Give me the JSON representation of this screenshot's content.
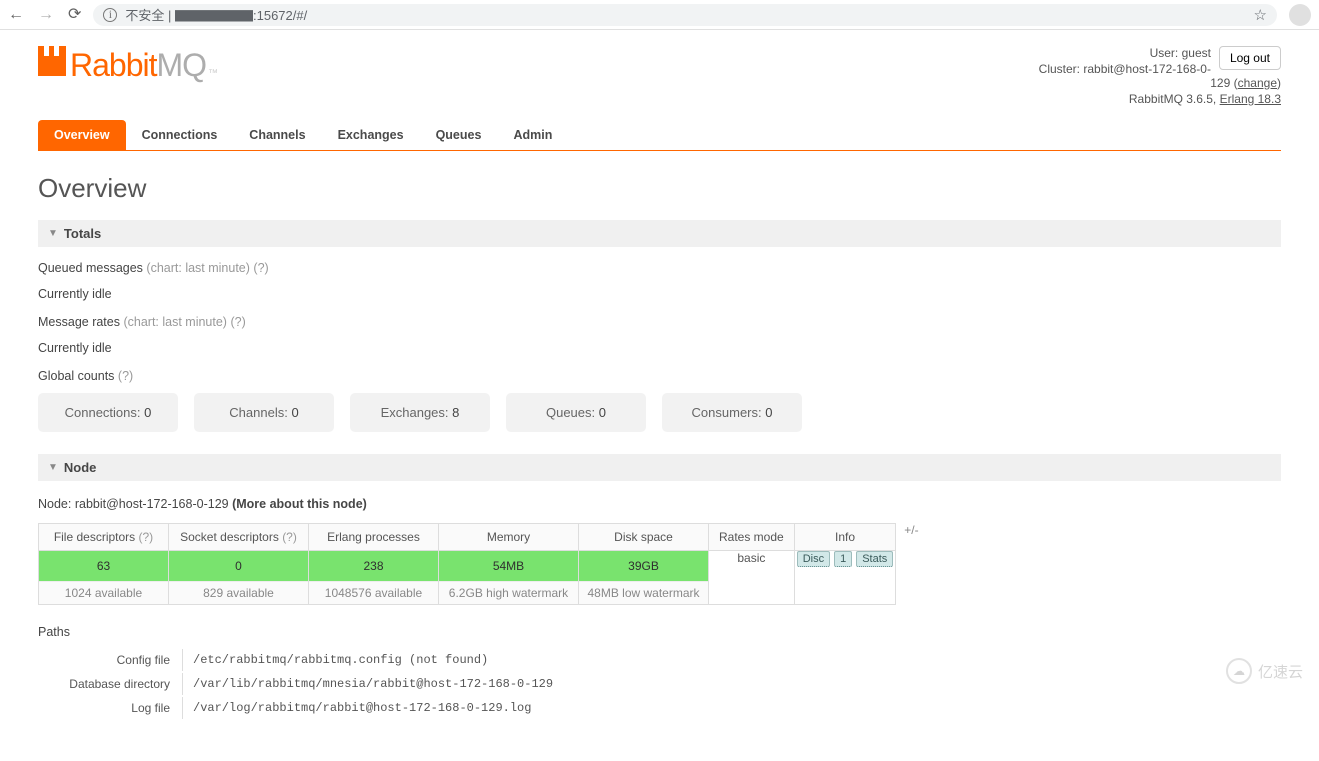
{
  "chrome": {
    "url_prefix": "不安全 |",
    "url": ":15672/#/",
    "url_text": "不安全 | ▇▇▇▇▇▇:15672/#/"
  },
  "logo": {
    "part1": "Rabbit",
    "part2": "MQ",
    "tm": "™"
  },
  "header": {
    "user_label": "User:",
    "user": "guest",
    "cluster_label": "Cluster:",
    "cluster": "rabbit@host-172-168-0-129",
    "change": "change",
    "version": "RabbitMQ 3.6.5,",
    "erlang": "Erlang 18.3",
    "logout": "Log out"
  },
  "tabs": [
    "Overview",
    "Connections",
    "Channels",
    "Exchanges",
    "Queues",
    "Admin"
  ],
  "page_title": "Overview",
  "sections": {
    "totals": "Totals",
    "node": "Node"
  },
  "totals": {
    "queued_label": "Queued messages",
    "chart_hint": "(chart: last minute)",
    "help": "(?)",
    "idle1": "Currently idle",
    "rates_label": "Message rates",
    "idle2": "Currently idle",
    "global_label": "Global counts"
  },
  "counts": [
    {
      "label": "Connections:",
      "value": "0"
    },
    {
      "label": "Channels:",
      "value": "0"
    },
    {
      "label": "Exchanges:",
      "value": "8"
    },
    {
      "label": "Queues:",
      "value": "0"
    },
    {
      "label": "Consumers:",
      "value": "0"
    }
  ],
  "node": {
    "line_label": "Node:",
    "name": "rabbit@host-172-168-0-129",
    "more": "(More about this node)",
    "headers": [
      "File descriptors",
      "Socket descriptors",
      "Erlang processes",
      "Memory",
      "Disk space",
      "Rates mode",
      "Info"
    ],
    "help": "(?)",
    "cells": {
      "fd_val": "63",
      "fd_sub": "1024 available",
      "sd_val": "0",
      "sd_sub": "829 available",
      "ep_val": "238",
      "ep_sub": "1048576 available",
      "mem_val": "54MB",
      "mem_sub": "6.2GB high watermark",
      "disk_val": "39GB",
      "disk_sub": "48MB low watermark",
      "rates": "basic",
      "info": [
        "Disc",
        "1",
        "Stats"
      ]
    },
    "plusminus": "+/-"
  },
  "paths": {
    "title": "Paths",
    "rows": [
      {
        "label": "Config file",
        "value": "/etc/rabbitmq/rabbitmq.config (not found)"
      },
      {
        "label": "Database directory",
        "value": "/var/lib/rabbitmq/mnesia/rabbit@host-172-168-0-129"
      },
      {
        "label": "Log file",
        "value": "/var/log/rabbitmq/rabbit@host-172-168-0-129.log"
      }
    ]
  },
  "watermark": "亿速云"
}
